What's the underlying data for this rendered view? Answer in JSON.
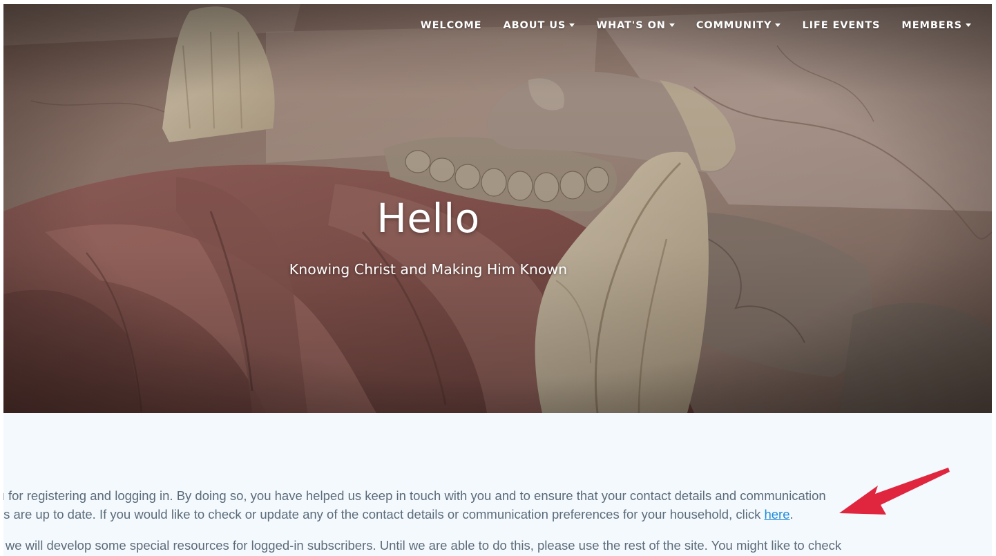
{
  "nav": {
    "items": [
      {
        "label": "WELCOME",
        "has_dropdown": false
      },
      {
        "label": "ABOUT US",
        "has_dropdown": true
      },
      {
        "label": "WHAT'S ON",
        "has_dropdown": true
      },
      {
        "label": "COMMUNITY",
        "has_dropdown": true
      },
      {
        "label": "LIFE EVENTS",
        "has_dropdown": false
      },
      {
        "label": "MEMBERS",
        "has_dropdown": true
      }
    ]
  },
  "hero": {
    "title": "Hello",
    "subtitle": "Knowing Christ and Making Him Known",
    "image": "stone-effigy-praying-hands"
  },
  "content": {
    "para1": {
      "line1": "you for registering and logging in. By doing so, you have helped us keep in touch with you and to ensure that your contact details and communication",
      "line2_before_link": "ences are up to date. If you would like to check or update any of the contact details or communication preferences for your household, click ",
      "link": "here",
      "line2_after_link": "."
    },
    "para2": {
      "line1": "me we will develop some special resources for logged-in subscribers. Until we are able to do this, please use the rest of the site. You might like to check"
    }
  },
  "annotation": {
    "arrow_color": "#e0263f",
    "icon": "red-pointer-arrow-icon"
  },
  "colors": {
    "content_background": "#f4f9fd",
    "body_text": "#5b6b7a",
    "link": "#1f8ad6",
    "nav_text": "#ffffff"
  }
}
